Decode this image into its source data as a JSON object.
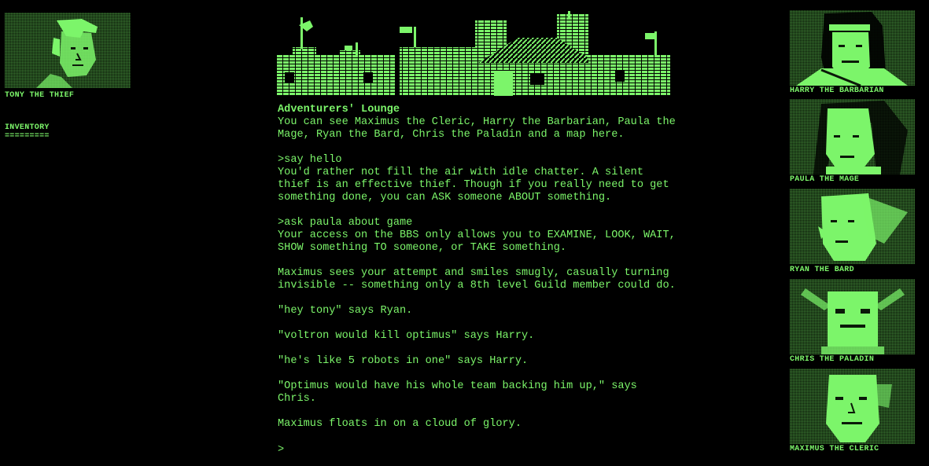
{
  "player": {
    "portrait_icon": "thief-face-icon",
    "name": "TONY THE THIEF"
  },
  "inventory": {
    "heading": "INVENTORY",
    "rule": "========="
  },
  "room": {
    "title": "Adventurers' Lounge",
    "description": "You can see Maximus the Cleric, Harry the Barbarian, Paula the Mage, Ryan the Bard, Chris the Paladin and a map here."
  },
  "log": [
    ">say hello",
    "You'd rather not fill the air with idle chatter. A silent thief is an effective thief. Though if you really need to get something done, you can ASK someone ABOUT something.",
    ">ask paula about game",
    "Your access on the BBS only allows you to EXAMINE, LOOK, WAIT, SHOW something TO someone, or TAKE something.",
    "Maximus sees your attempt and smiles smugly, casually turning invisible -- something only a 8th level Guild member could do.",
    "\"hey tony\" says Ryan.",
    "\"voltron would kill optimus\" says Harry.",
    "\"he's like 5 robots in one\" says Harry.",
    "\"Optimus would have his whole team backing him up,\" says Chris.",
    "Maximus floats in on a cloud of glory."
  ],
  "prompt": ">",
  "party": [
    {
      "name": "HARRY THE BARBARIAN",
      "icon": "barbarian-face-icon"
    },
    {
      "name": "PAULA THE MAGE",
      "icon": "mage-face-icon"
    },
    {
      "name": "RYAN THE BARD",
      "icon": "bard-face-icon"
    },
    {
      "name": "CHRIS THE PALADIN",
      "icon": "paladin-helmet-icon"
    },
    {
      "name": "MAXIMUS THE CLERIC",
      "icon": "cleric-face-icon"
    }
  ],
  "colors": {
    "phosphor": "#7CF56A",
    "background": "#000000"
  }
}
